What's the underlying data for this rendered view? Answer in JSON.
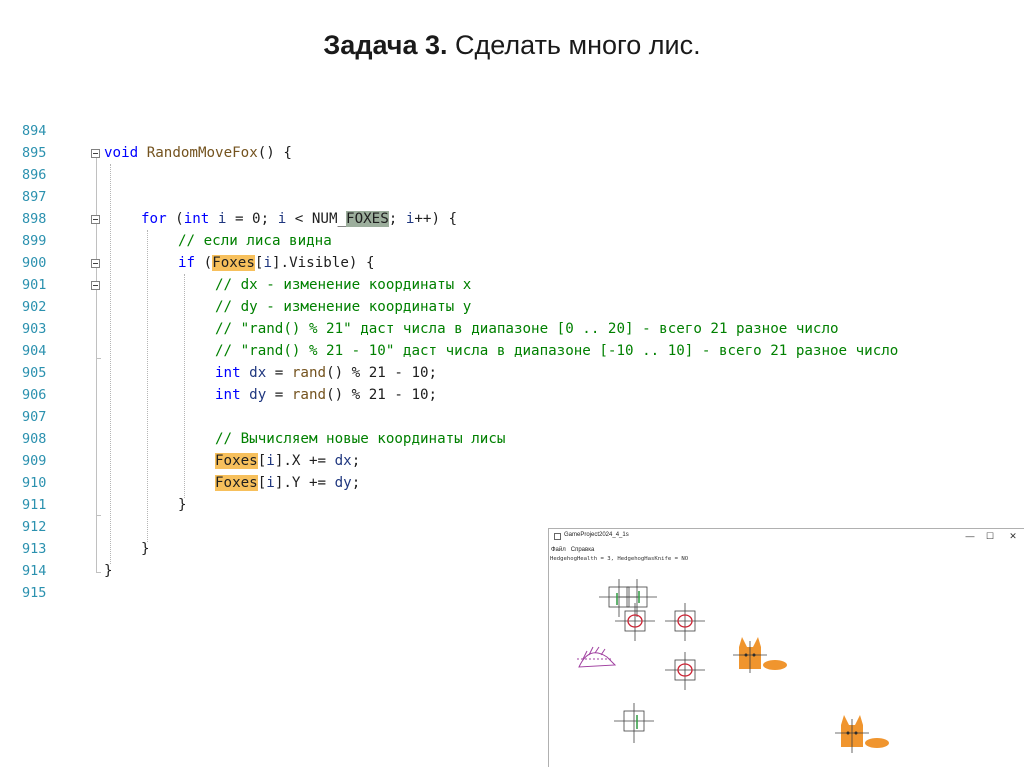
{
  "slide": {
    "title_bold": "Задача 3.",
    "title_rest": " Сделать много лис."
  },
  "editor": {
    "line_numbers": [
      "894",
      "895",
      "896",
      "897",
      "898",
      "899",
      "900",
      "901",
      "902",
      "903",
      "904",
      "905",
      "906",
      "907",
      "908",
      "909",
      "910",
      "911",
      "912",
      "913",
      "914",
      "915"
    ],
    "l895": {
      "kw": "void",
      "fn": "RandomMoveFox",
      "rest": "() {"
    },
    "l898": {
      "kw_for": "for",
      "p1": " (",
      "kw_int": "int",
      "p2": " ",
      "v1": "i",
      "p3": " = 0; ",
      "v2": "i",
      "p4": " < NUM_",
      "mac": "FOXES",
      "p5": "; ",
      "v3": "i",
      "p6": "++) {"
    },
    "l899": "// если лиса видна",
    "l900": {
      "kw": "if",
      "p1": " (",
      "arr": "Foxes",
      "p2": "[",
      "v": "i",
      "p3": "].Visible) {"
    },
    "l901": "// dx - изменение координаты x",
    "l902": "// dy - изменение координаты y",
    "l903": "// \"rand() % 21\" даст числа в диапазоне [0 .. 20] - всего 21 разное число",
    "l904": "// \"rand() % 21 - 10\" даст числа в диапазоне [-10 .. 10] - всего 21 разное число",
    "l905": {
      "kw": "int",
      "v": "dx",
      "p1": " = ",
      "fn": "rand",
      "p2": "() % 21 - 10;"
    },
    "l906": {
      "kw": "int",
      "v": "dy",
      "p1": " = ",
      "fn": "rand",
      "p2": "() % 21 - 10;"
    },
    "l908": "// Вычисляем новые координаты лисы",
    "l909": {
      "arr": "Foxes",
      "p1": "[",
      "v": "i",
      "p2": "].X += ",
      "v2": "dx",
      "p3": ";"
    },
    "l910": {
      "arr": "Foxes",
      "p1": "[",
      "v": "i",
      "p2": "].Y += ",
      "v2": "dy",
      "p3": ";"
    },
    "brace_close": "}"
  },
  "game_window": {
    "title": "GameProject2024_4_1s",
    "minimize": "—",
    "maximize": "☐",
    "close": "✕",
    "menu": [
      "Файл",
      "Справка"
    ],
    "status": "HedgehogHealth = 3, HedgehogHasKnife = NO",
    "colors": {
      "fox": "#f0952e",
      "ring": "#cc2233",
      "hedgehog": "#a040a0",
      "cross": "#404040",
      "marker": "#2e9a40"
    },
    "sprites": [
      "cross-target",
      "cross-target",
      "cross-target",
      "cross-target",
      "cross-target",
      "ring-target",
      "ring-target",
      "ring-target",
      "hedgehog",
      "fox",
      "fox"
    ]
  }
}
